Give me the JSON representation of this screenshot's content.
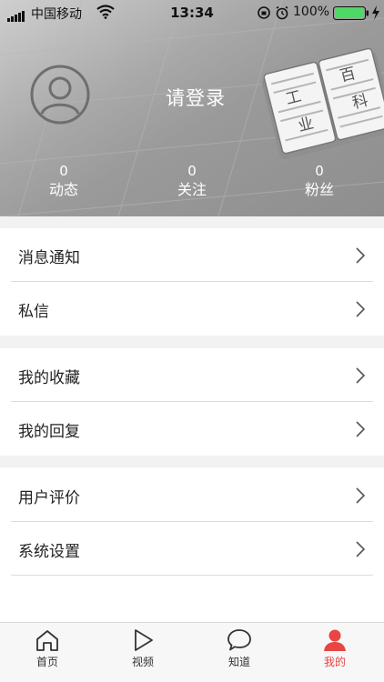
{
  "status_bar": {
    "carrier": "中国移动",
    "time": "13:34",
    "battery_percent": "100%",
    "battery_level": 1.0
  },
  "header": {
    "login_text": "请登录",
    "book_chars": [
      "工",
      "业",
      "百",
      "科"
    ],
    "stats": [
      {
        "value": "0",
        "label": "动态"
      },
      {
        "value": "0",
        "label": "关注"
      },
      {
        "value": "0",
        "label": "粉丝"
      }
    ]
  },
  "menu": {
    "group1": [
      {
        "label": "消息通知"
      },
      {
        "label": "私信"
      }
    ],
    "group2": [
      {
        "label": "我的收藏"
      },
      {
        "label": "我的回复"
      }
    ],
    "group3": [
      {
        "label": "用户评价"
      },
      {
        "label": "系统设置"
      }
    ]
  },
  "tab_bar": {
    "tabs": [
      {
        "label": "首页",
        "icon": "home-icon",
        "active": false
      },
      {
        "label": "视频",
        "icon": "play-icon",
        "active": false
      },
      {
        "label": "知道",
        "icon": "chat-bubble-icon",
        "active": false
      },
      {
        "label": "我的",
        "icon": "person-icon",
        "active": true
      }
    ],
    "active_color": "#e84545"
  },
  "colors": {
    "header_gradient_start": "#cfcfcf",
    "header_gradient_end": "#8e8e8e",
    "battery_green": "#4cd964"
  }
}
